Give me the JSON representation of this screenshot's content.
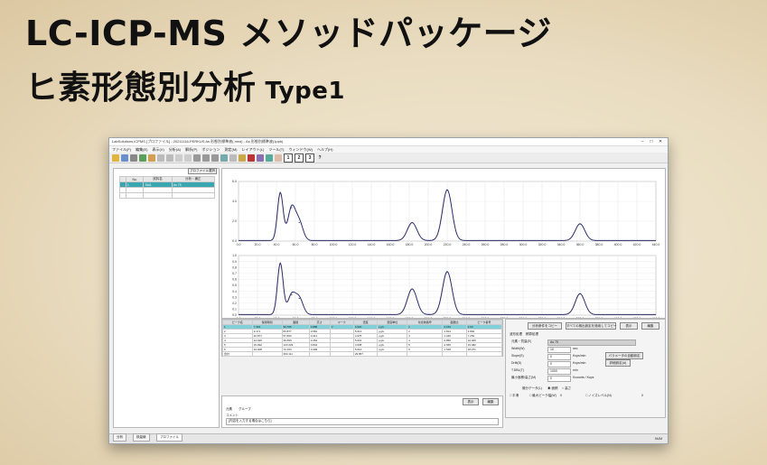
{
  "heading": {
    "line1": "LC-ICP-MS メソッドパッケージ",
    "line2": "ヒ素形態別分析",
    "type_label": "Type1"
  },
  "window": {
    "title": "LabSolutions ICPMS [プロファイル] - 20211116-PERKUS As 形態別標準液(.mxd) - As 形態別標準液(1ppb)",
    "menu": [
      "ファイル(F)",
      "編集(E)",
      "表示(V)",
      "分析(A)",
      "解析(P)",
      "ポジション",
      "測定(M)",
      "レイアウト(L)",
      "ツール(T)",
      "ウィンドウ(W)",
      "ヘルプ(H)"
    ],
    "toolbar_numbers": [
      "1",
      "2",
      "3"
    ],
    "toolbar_help": "?"
  },
  "sample_panel": {
    "profile_button": "プロファイル選択",
    "columns": [
      "",
      "No.",
      "試料名",
      "分析・補正"
    ],
    "rows": [
      [
        "",
        "1",
        "Std1",
        "As 75"
      ]
    ]
  },
  "chart_data": {
    "type": "line",
    "xlim": [
      0,
      440
    ],
    "x_ticks": [
      "0.0",
      "20.0",
      "40.0",
      "60.0",
      "80.0",
      "100.0",
      "120.0",
      "140.0",
      "160.0",
      "180.0",
      "200.0",
      "220.0",
      "240.0",
      "260.0",
      "280.0",
      "300.0",
      "320.0",
      "340.0",
      "360.0",
      "380.0",
      "400.0",
      "420.0",
      "440.0"
    ],
    "top_y_ticks": [
      "6.0",
      "4.0",
      "2.0",
      "0.0"
    ],
    "bottom_y_ticks": [
      "1.0",
      "0.9",
      "0.8",
      "0.7",
      "0.6",
      "0.5",
      "0.4",
      "0.3",
      "0.2",
      "0.1",
      "0.0"
    ],
    "peaks": [
      {
        "center": 44,
        "top": 0.8,
        "bottom": 0.86,
        "width": 3
      },
      {
        "center": 56,
        "top": 0.55,
        "bottom": 0.33,
        "width": 4
      },
      {
        "center": 64,
        "top": 0.3,
        "bottom": 0.27,
        "width": 4
      },
      {
        "center": 183,
        "top": 0.3,
        "bottom": 0.43,
        "width": 5
      },
      {
        "center": 220,
        "top": 0.85,
        "bottom": 0.72,
        "width": 5
      },
      {
        "center": 360,
        "top": 0.28,
        "bottom": 0.35,
        "width": 5
      }
    ],
    "colors": {
      "trace": "#1a2a6c",
      "overlay": "#c0392b"
    }
  },
  "results_table": {
    "columns": [
      "ピーク名",
      "保持時間",
      "面積",
      "高さ",
      "マーク",
      "濃度",
      "濃度単位",
      "化合物番号",
      "面積比",
      "ピーク番号"
    ],
    "rows": [
      [
        "1",
        "7.394",
        "99.705",
        "0.888",
        "V",
        "4.920",
        "μg/L",
        "1",
        "2.153",
        "2.00"
      ],
      [
        "2",
        "9.171",
        "83.877",
        "0.581",
        "",
        "5.013",
        "μg/L",
        "2",
        "1.814",
        "3.892"
      ],
      [
        "3",
        "10.877",
        "57.600",
        "0.311",
        "",
        "4.975",
        "μg/L",
        "3",
        "1.246",
        "7.256"
      ],
      [
        "4",
        "14.029",
        "39.559",
        "0.454",
        "",
        "5.001",
        "μg/L",
        "4",
        "0.856",
        "10.406"
      ],
      [
        "5",
        "15.092",
        "123.229",
        "0.844",
        "",
        "4.938",
        "μg/L",
        "5",
        "2.665",
        "15.482"
      ],
      [
        "6",
        "19.008",
        "70.153",
        "0.309",
        "",
        "5.010",
        "μg/L",
        "6",
        "1.518",
        "18.271"
      ]
    ],
    "total_row": [
      "合計",
      "",
      "394.111",
      "",
      "",
      "29.857",
      "",
      "",
      "",
      ""
    ]
  },
  "settings_panel": {
    "top_buttons": [
      "分析条件をコピー",
      "すべての検出設定を適用してコピー",
      "表示",
      "編集"
    ],
    "tabs": [
      "波形処理",
      "積算処理"
    ],
    "fields": [
      {
        "label": "元素・質量(E)",
        "value": "As 75"
      },
      {
        "label": "Width(W)",
        "value": "10",
        "unit": "sec"
      },
      {
        "label": "Slope(S)",
        "value": "0",
        "unit": "Kcps/min"
      },
      {
        "label": "Drift(D)",
        "value": "0",
        "unit": "Kcps/min"
      },
      {
        "label": "T.DBL(T)",
        "value": "1000",
        "unit": "min"
      },
      {
        "label": "最小面積/高さ(M)",
        "value": "0",
        "unit": "Kcounts / Kcps"
      }
    ],
    "side_buttons": [
      "パラメータの自動設定",
      "詳細設定(A)"
    ],
    "smoothing_label": "微分データ(L)",
    "options": [
      "面積",
      "高さ"
    ],
    "bottom_options": [
      "平滑",
      "最大ピーク幅(W)",
      "ノイズレベル(N)"
    ],
    "bottom_values": [
      "0",
      "0"
    ]
  },
  "bottom_panel": {
    "tabs": [
      "元素",
      "グループ"
    ],
    "buttons": [
      "表示",
      "編集"
    ],
    "memo_label": "コメント",
    "memo_placeholder": "[内容を入力する場合はこちら]"
  },
  "status_tabs": [
    "分析",
    "検量線",
    "プロファイル"
  ],
  "status_right": "NUM"
}
